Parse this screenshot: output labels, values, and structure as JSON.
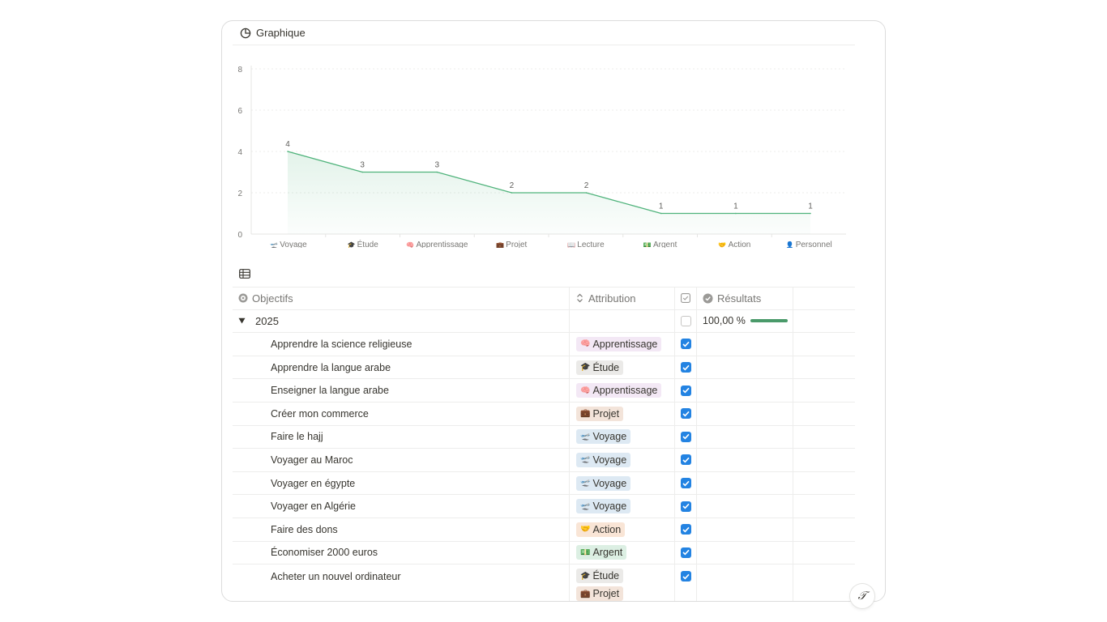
{
  "chart_view": {
    "title": "Graphique",
    "icon": "pie-chart-icon"
  },
  "chart_data": {
    "type": "area",
    "x": [
      "Voyage",
      "Étude",
      "Apprentissage",
      "Projet",
      "Lecture",
      "Argent",
      "Action",
      "Personnel"
    ],
    "x_icons": [
      "🛫",
      "🎓",
      "🧠",
      "💼",
      "📖",
      "💵",
      "🤝",
      "👤"
    ],
    "values": [
      4,
      3,
      3,
      2,
      2,
      1,
      1,
      1
    ],
    "ylim": [
      0,
      8
    ],
    "yticks": [
      "0",
      "2",
      "4",
      "6",
      "8"
    ],
    "grid": true,
    "color": "#4fb37b"
  },
  "table_view": {
    "icon": "table-icon"
  },
  "table": {
    "columns": [
      {
        "label": "Objectifs",
        "icon": "target-icon"
      },
      {
        "label": "Attribution",
        "icon": "select-icon"
      },
      {
        "label": "",
        "icon": "checkbox-icon"
      },
      {
        "label": "Résultats",
        "icon": "verified-icon"
      }
    ],
    "group": {
      "label": "2025",
      "result": "100,00 %",
      "progress": 1.0
    },
    "rows": [
      {
        "name": "Apprendre la science religieuse",
        "tags": [
          {
            "emoji": "🧠",
            "label": "Apprentissage",
            "color": "purple"
          }
        ],
        "checked": true
      },
      {
        "name": "Apprendre la langue arabe",
        "tags": [
          {
            "emoji": "🎓",
            "label": "Étude",
            "color": "gray"
          }
        ],
        "checked": true
      },
      {
        "name": "Enseigner la langue arabe",
        "tags": [
          {
            "emoji": "🧠",
            "label": "Apprentissage",
            "color": "purple"
          }
        ],
        "checked": true
      },
      {
        "name": "Créer mon commerce",
        "tags": [
          {
            "emoji": "💼",
            "label": "Projet",
            "color": "brown"
          }
        ],
        "checked": true
      },
      {
        "name": "Faire le hajj",
        "tags": [
          {
            "emoji": "🛫",
            "label": "Voyage",
            "color": "blue"
          }
        ],
        "checked": true
      },
      {
        "name": "Voyager au Maroc",
        "tags": [
          {
            "emoji": "🛫",
            "label": "Voyage",
            "color": "blue"
          }
        ],
        "checked": true
      },
      {
        "name": "Voyager en égypte",
        "tags": [
          {
            "emoji": "🛫",
            "label": "Voyage",
            "color": "blue"
          }
        ],
        "checked": true
      },
      {
        "name": "Voyager en Algérie",
        "tags": [
          {
            "emoji": "🛫",
            "label": "Voyage",
            "color": "blue"
          }
        ],
        "checked": true
      },
      {
        "name": "Faire des dons",
        "tags": [
          {
            "emoji": "🤝",
            "label": "Action",
            "color": "orange"
          }
        ],
        "checked": true
      },
      {
        "name": "Économiser 2000 euros",
        "tags": [
          {
            "emoji": "💵",
            "label": "Argent",
            "color": "green"
          }
        ],
        "checked": true
      },
      {
        "name": "Acheter un nouvel ordinateur",
        "tags": [
          {
            "emoji": "🎓",
            "label": "Étude",
            "color": "gray"
          },
          {
            "emoji": "💼",
            "label": "Projet",
            "color": "brown"
          }
        ],
        "checked": true
      }
    ]
  },
  "help_button": {
    "label": "?"
  }
}
